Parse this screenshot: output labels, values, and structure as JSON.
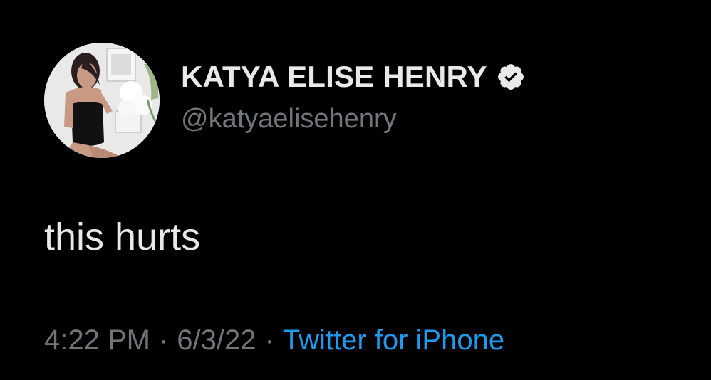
{
  "author": {
    "display_name": "KATYA ELISE HENRY",
    "handle": "@katyaelisehenry",
    "verified": true,
    "avatar_icon": "profile-photo"
  },
  "tweet": {
    "text": "this hurts"
  },
  "meta": {
    "time": "4:22 PM",
    "date": "6/3/22",
    "separator": "·",
    "source": "Twitter for iPhone"
  },
  "colors": {
    "background": "#000000",
    "primary_text": "#e7e9ea",
    "secondary_text": "#71767b",
    "link": "#1d9bf0"
  }
}
